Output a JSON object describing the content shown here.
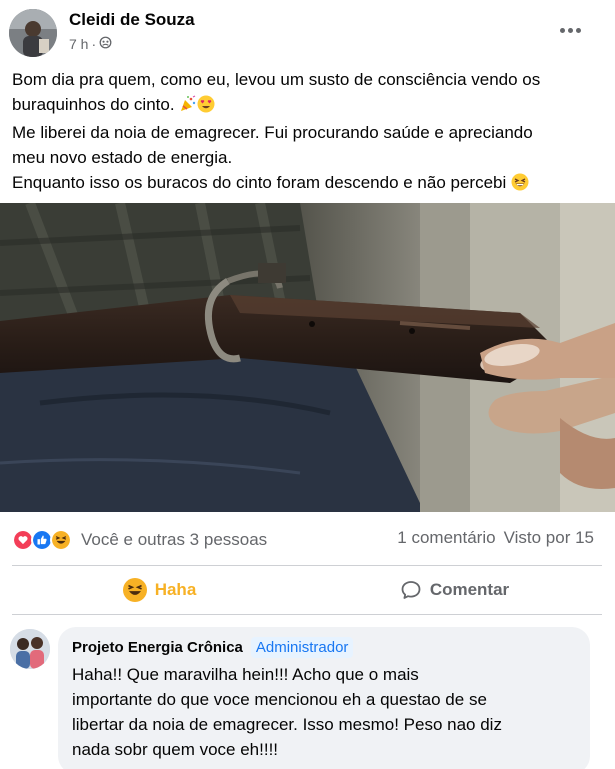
{
  "post": {
    "author": "Cleidi de Souza",
    "time": "7 h",
    "separator": "·",
    "text_lines": [
      "Bom dia pra quem, como eu, levou um susto de consciência vendo os",
      "buraquinhos do cinto.",
      "Me liberei da noia de emagrecer. Fui procurando saúde e apreciando",
      "meu novo estado de energia.",
      "Enquanto isso os buracos do cinto foram descendo e não percebi"
    ],
    "inline_emojis": [
      "party-popper",
      "heart-eyes",
      "grinning-squint"
    ],
    "image_alt": "cinto de couro marrom"
  },
  "reactions": {
    "icons": [
      "love",
      "like",
      "haha"
    ],
    "summary": "Você e outras 3 pessoas",
    "comments_count": "1 comentário",
    "seen_by": "Visto por 15"
  },
  "actions": {
    "haha_label": "Haha",
    "comment_label": "Comentar"
  },
  "comment": {
    "author": "Projeto Energia Crônica",
    "badge": "Administrador",
    "text_lines": [
      "Haha!! Que maravilha hein!!! Acho que o mais",
      "importante do que voce mencionou eh a questao de se",
      "libertar da noia de emagrecer. Isso mesmo! Peso nao diz",
      "nada sobr quem voce eh!!!!"
    ]
  },
  "colors": {
    "muted": "#65676b",
    "divider": "#ced0d4",
    "bubble": "#f0f2f5",
    "link": "#1877f2",
    "haha": "#f7b125"
  }
}
